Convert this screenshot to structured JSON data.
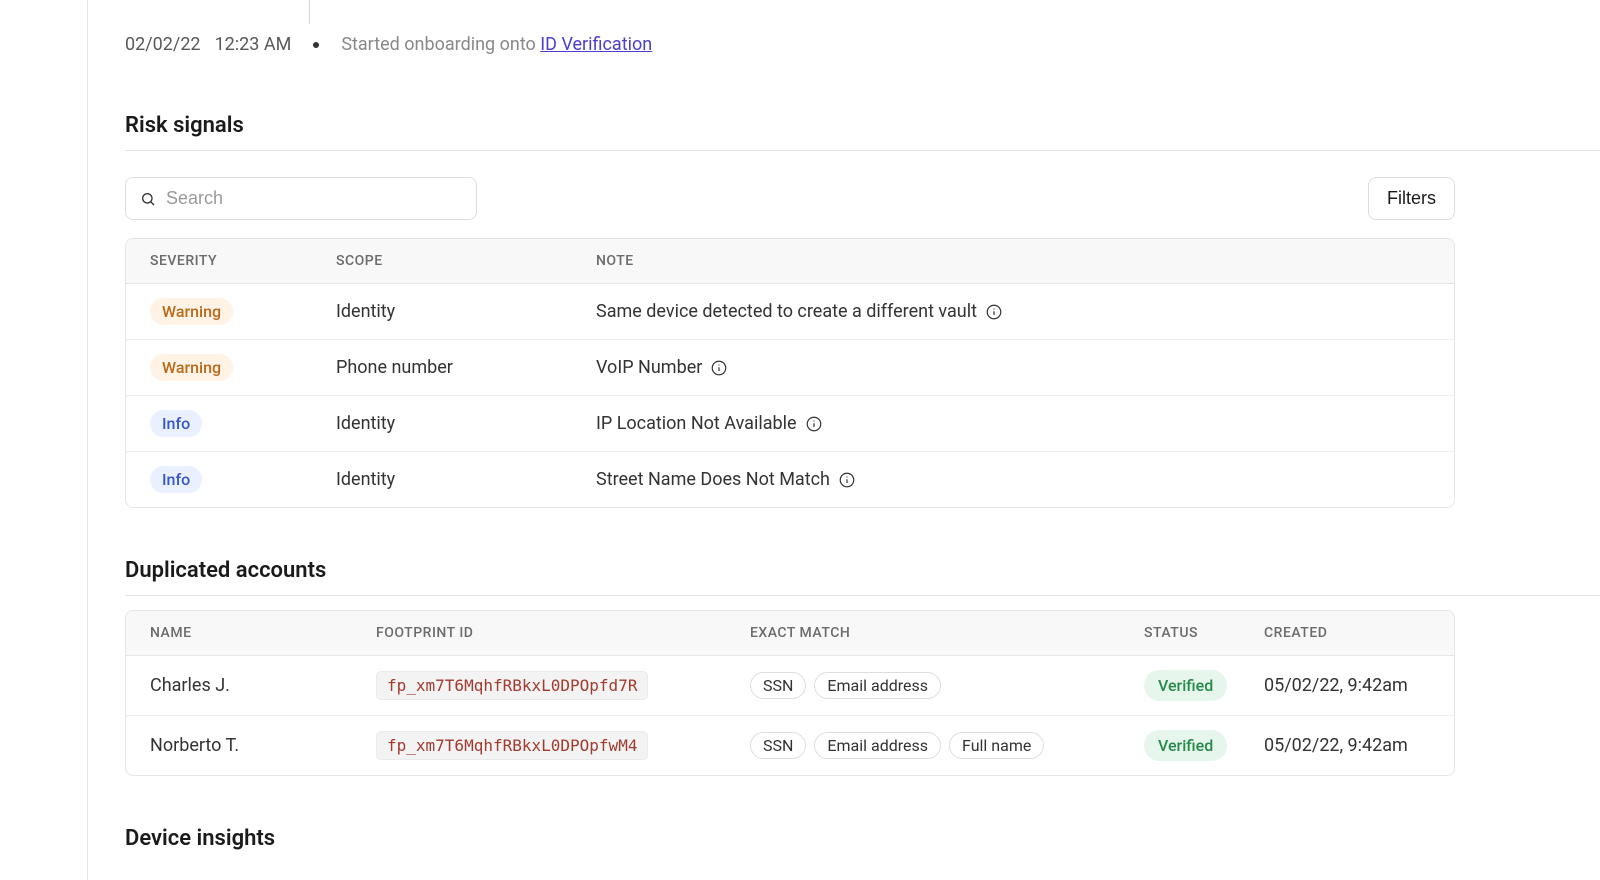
{
  "timeline": {
    "date": "02/02/22",
    "time": "12:23 AM",
    "prefix": "Started onboarding onto ",
    "link": "ID Verification"
  },
  "risk": {
    "title": "Risk signals",
    "search_placeholder": "Search",
    "filters_label": "Filters",
    "columns": {
      "severity": "SEVERITY",
      "scope": "SCOPE",
      "note": "NOTE"
    },
    "rows": [
      {
        "severity": "Warning",
        "severity_kind": "warning",
        "scope": "Identity",
        "note": "Same device detected to create a different vault"
      },
      {
        "severity": "Warning",
        "severity_kind": "warning",
        "scope": "Phone number",
        "note": "VoIP Number"
      },
      {
        "severity": "Info",
        "severity_kind": "info",
        "scope": "Identity",
        "note": "IP Location Not Available"
      },
      {
        "severity": "Info",
        "severity_kind": "info",
        "scope": "Identity",
        "note": "Street Name Does Not Match"
      }
    ]
  },
  "dup": {
    "title": "Duplicated accounts",
    "columns": {
      "name": "NAME",
      "fp": "FOOTPRINT ID",
      "match": "EXACT MATCH",
      "status": "STATUS",
      "created": "CREATED"
    },
    "rows": [
      {
        "name": "Charles J.",
        "fp": "fp_xm7T6MqhfRBkxL0DPOpfd7R",
        "match": [
          "SSN",
          "Email address"
        ],
        "status": "Verified",
        "created": "05/02/22, 9:42am"
      },
      {
        "name": "Norberto T.",
        "fp": "fp_xm7T6MqhfRBkxL0DPOpfwM4",
        "match": [
          "SSN",
          "Email address",
          "Full name"
        ],
        "status": "Verified",
        "created": "05/02/22, 9:42am"
      }
    ]
  },
  "device": {
    "title": "Device insights"
  }
}
